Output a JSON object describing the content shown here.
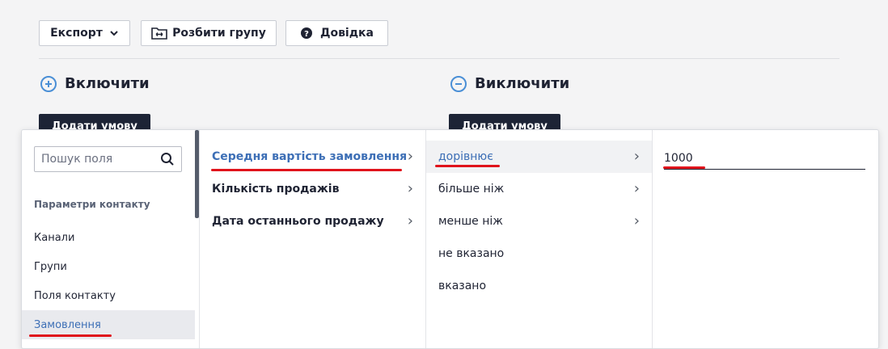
{
  "toolbar": {
    "export_label": "Експорт",
    "split_label": "Розбити групу",
    "help_label": "Довідка"
  },
  "include": {
    "title": "Включити",
    "add_label": "Додати умову"
  },
  "exclude": {
    "title": "Виключити",
    "add_label": "Додати умову"
  },
  "picker": {
    "search_placeholder": "Пошук поля",
    "category_heading": "Параметри контакту",
    "categories": [
      "Канали",
      "Групи",
      "Поля контакту",
      "Замовлення"
    ],
    "active_category": "Замовлення",
    "fields": [
      "Середня вартість замовлення",
      "Кількість продажів",
      "Дата останнього продажу"
    ],
    "active_field": "Середня вартість замовлення",
    "operators": [
      "дорівнює",
      "більше ніж",
      "менше ніж",
      "не вказано",
      "вказано"
    ],
    "active_operator": "дорівнює",
    "value": "1000"
  },
  "colors": {
    "accent": "#3d6fb6",
    "dark_button": "#1d2436",
    "annotation": "#e0141c"
  }
}
